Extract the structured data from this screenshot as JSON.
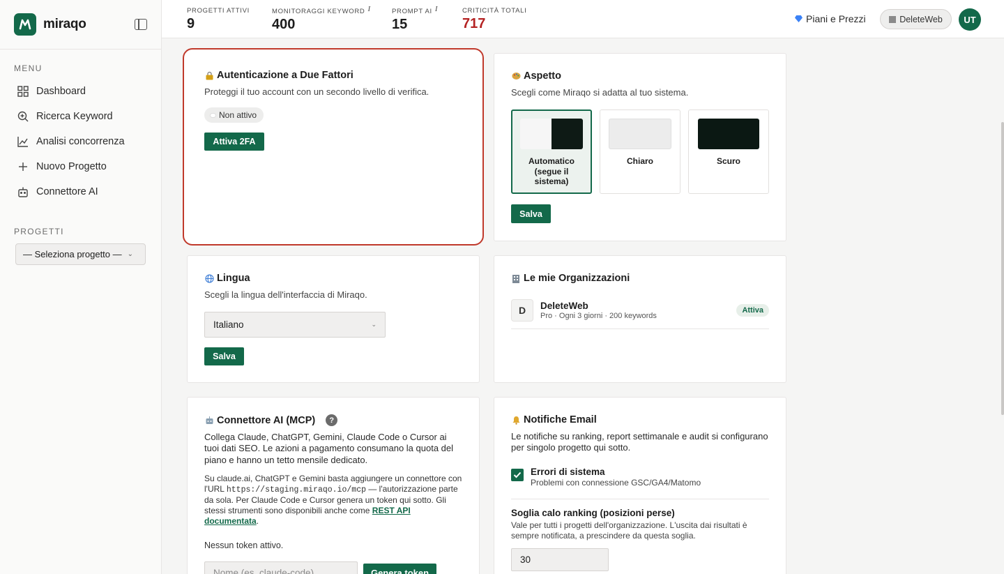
{
  "brand": {
    "name": "miraqo",
    "accent": "#13694a"
  },
  "sidebar": {
    "menu_label": "MENU",
    "items": [
      {
        "label": "Dashboard",
        "icon": "grid-icon"
      },
      {
        "label": "Ricerca Keyword",
        "icon": "search-plus-icon"
      },
      {
        "label": "Analisi concorrenza",
        "icon": "chart-line-icon"
      },
      {
        "label": "Nuovo Progetto",
        "icon": "plus-icon"
      },
      {
        "label": "Connettore AI",
        "icon": "robot-icon"
      }
    ],
    "projects_label": "PROGETTI",
    "project_select": "— Seleziona progetto —"
  },
  "topbar": {
    "stats": [
      {
        "label": "PROGETTI ATTIVI",
        "value": "9"
      },
      {
        "label": "MONITORAGGI KEYWORD",
        "value": "400",
        "info": "i"
      },
      {
        "label": "PROMPT AI",
        "value": "15",
        "info": "i"
      },
      {
        "label": "CRITICITÀ TOTALI",
        "value": "717"
      }
    ],
    "plans_label": "Piani e Prezzi",
    "org_label": "DeleteWeb",
    "avatar": "UT"
  },
  "twofa": {
    "title": "Autenticazione a Due Fattori",
    "desc": "Proteggi il tuo account con un secondo livello di verifica.",
    "status": "Non attivo",
    "button": "Attiva 2FA"
  },
  "appearance": {
    "title": "Aspetto",
    "desc": "Scegli come Miraqo si adatta al tuo sistema.",
    "options": [
      "Automatico (segue il sistema)",
      "Chiaro",
      "Scuro"
    ],
    "selected": "Automatico (segue il sistema)",
    "button": "Salva"
  },
  "language": {
    "title": "Lingua",
    "desc": "Scegli la lingua dell'interfaccia di Miraqo.",
    "value": "Italiano",
    "button": "Salva"
  },
  "orgs": {
    "title": "Le mie Organizzazioni",
    "items": [
      {
        "initial": "D",
        "name": "DeleteWeb",
        "meta": "Pro · Ogni 3 giorni · 200 keywords",
        "badge": "Attiva"
      }
    ]
  },
  "mcp": {
    "title": "Connettore AI (MCP)",
    "help": "?",
    "desc": "Collega Claude, ChatGPT, Gemini, Claude Code o Cursor ai tuoi dati SEO. Le azioni a pagamento consumano la quota del piano e hanno un tetto mensile dedicato.",
    "detail_pre": "Su claude.ai, ChatGPT e Gemini basta aggiungere un connettore con l'URL ",
    "detail_url": "https://staging.miraqo.io/mcp",
    "detail_post": " — l'autorizzazione parte da sola. Per Claude Code e Cursor genera un token qui sotto. Gli stessi strumenti sono disponibili anche come ",
    "detail_link": "REST API documentata",
    "detail_end": ".",
    "no_token": "Nessun token attivo.",
    "input_placeholder": "Nome (es. claude-code)",
    "button": "Genera token"
  },
  "notifications": {
    "title": "Notifiche Email",
    "desc": "Le notifiche su ranking, report settimanale e audit si configurano per singolo progetto qui sotto.",
    "check_title": "Errori di sistema",
    "check_sub": "Problemi con connessione GSC/GA4/Matomo",
    "checked": true,
    "threshold_label": "Soglia calo ranking (posizioni perse)",
    "threshold_desc": "Vale per tutti i progetti dell'organizzazione. L'uscita dai risultati è sempre notificata, a prescindere da questa soglia.",
    "threshold_value": "30"
  }
}
